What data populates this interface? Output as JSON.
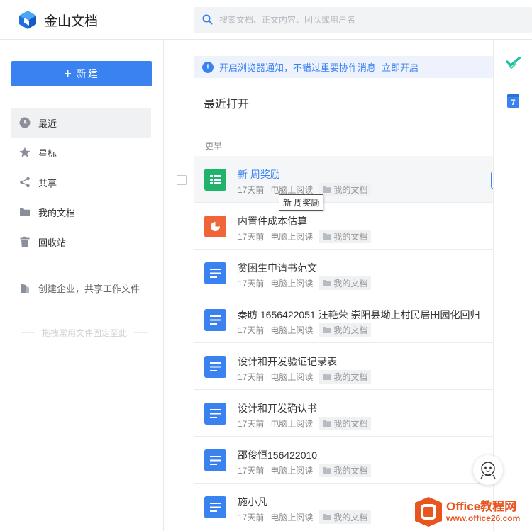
{
  "app": {
    "name": "金山文档"
  },
  "search": {
    "placeholder": "搜索文档、正文内容、团队或用户名"
  },
  "sidebar": {
    "new_label": "新建",
    "items": [
      {
        "label": "最近",
        "icon": "clock-icon"
      },
      {
        "label": "星标",
        "icon": "star-icon"
      },
      {
        "label": "共享",
        "icon": "share-icon"
      },
      {
        "label": "我的文档",
        "icon": "folder-icon"
      },
      {
        "label": "回收站",
        "icon": "trash-icon"
      }
    ],
    "enterprise_label": "创建企业，共享工作文件",
    "drop_hint": "拖拽常用文件固定至此"
  },
  "notice": {
    "text": "开启浏览器通知，不错过重要协作消息",
    "link": "立即开启"
  },
  "main": {
    "section_title": "最近打开",
    "group_label": "更早",
    "tooltip": "新 周奖励",
    "files": [
      {
        "name": "新 周奖励",
        "time": "17天前",
        "source": "电脑上阅读",
        "folder": "我的文档",
        "type": "sheet"
      },
      {
        "name": "内置件成本估算",
        "time": "17天前",
        "source": "电脑上阅读",
        "folder": "我的文档",
        "type": "slides"
      },
      {
        "name": "贫困生申请书范文",
        "time": "17天前",
        "source": "电脑上阅读",
        "folder": "我的文档",
        "type": "doc"
      },
      {
        "name": "秦昉  1656422051  汪艳荣  崇阳县坳上村民居田园化回归",
        "time": "17天前",
        "source": "电脑上阅读",
        "folder": "我的文档",
        "type": "doc"
      },
      {
        "name": "设计和开发验证记录表",
        "time": "17天前",
        "source": "电脑上阅读",
        "folder": "我的文档",
        "type": "doc"
      },
      {
        "name": "设计和开发确认书",
        "time": "17天前",
        "source": "电脑上阅读",
        "folder": "我的文档",
        "type": "doc"
      },
      {
        "name": "邵俊恒156422010",
        "time": "17天前",
        "source": "电脑上阅读",
        "folder": "我的文档",
        "type": "doc"
      },
      {
        "name": "施小凡",
        "time": "17天前",
        "source": "电脑上阅读",
        "folder": "我的文档",
        "type": "doc"
      }
    ]
  },
  "rail": {
    "calendar_day": "7"
  },
  "watermark": {
    "main": "Office教程网",
    "sub": "www.office26.com"
  },
  "colors": {
    "accent": "#3a82f0",
    "sheet": "#1fb36b",
    "slides": "#f0643a",
    "doc": "#3a82f0"
  }
}
